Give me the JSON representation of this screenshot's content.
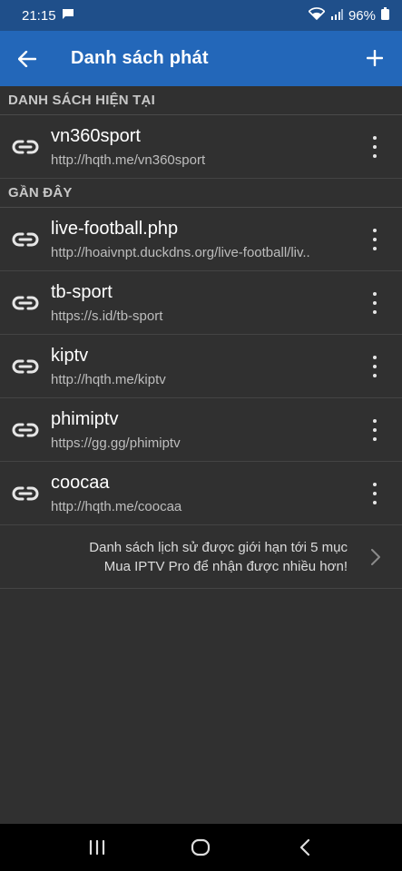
{
  "status": {
    "time": "21:15",
    "battery": "96%"
  },
  "appbar": {
    "title": "Danh sách phát"
  },
  "current_section": {
    "header": "DANH SÁCH HIỆN TẠI",
    "items": [
      {
        "name": "vn360sport",
        "url": "http://hqth.me/vn360sport"
      }
    ]
  },
  "recent_section": {
    "header": "GẦN ĐÂY",
    "items": [
      {
        "name": "live-football.php",
        "url": "http://hoaivnpt.duckdns.org/live-football/liv.."
      },
      {
        "name": "tb-sport",
        "url": "https://s.id/tb-sport"
      },
      {
        "name": "kiptv",
        "url": "http://hqth.me/kiptv"
      },
      {
        "name": "phimiptv",
        "url": "https://gg.gg/phimiptv"
      },
      {
        "name": "coocaa",
        "url": "http://hqth.me/coocaa"
      }
    ]
  },
  "notice": {
    "line1": "Danh sách lịch sử được giới hạn tới 5 mục",
    "line2": "Mua IPTV Pro để nhận được nhiều hơn!"
  },
  "colors": {
    "statusbar": "#1f4f8a",
    "appbar": "#2367b9",
    "background": "#303030"
  }
}
